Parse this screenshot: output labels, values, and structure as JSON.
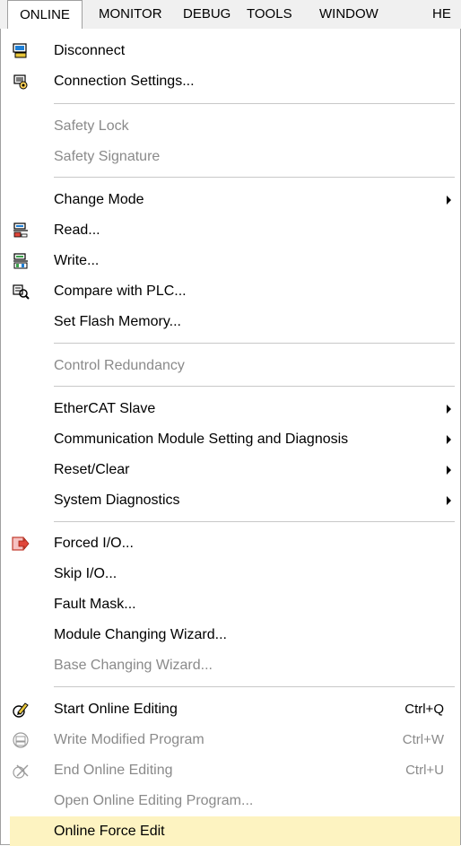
{
  "menubar": {
    "items": [
      "ONLINE",
      "MONITOR",
      "DEBUG",
      "TOOLS",
      "WINDOW",
      "HE"
    ]
  },
  "menu": {
    "disconnect": "Disconnect",
    "connection_settings": "Connection Settings...",
    "safety_lock": "Safety Lock",
    "safety_signature": "Safety Signature",
    "change_mode": "Change Mode",
    "read": "Read...",
    "write": "Write...",
    "compare_with_plc": "Compare with PLC...",
    "set_flash_memory": "Set Flash Memory...",
    "control_redundancy": "Control Redundancy",
    "ethercat_slave": "EtherCAT Slave",
    "comm_module": "Communication Module Setting and Diagnosis",
    "reset_clear": "Reset/Clear",
    "system_diagnostics": "System Diagnostics",
    "forced_io": "Forced I/O...",
    "skip_io": "Skip I/O...",
    "fault_mask": "Fault Mask...",
    "module_changing_wizard": "Module Changing Wizard...",
    "base_changing_wizard": "Base Changing Wizard...",
    "start_online_editing": "Start Online Editing",
    "start_online_editing_shortcut": "Ctrl+Q",
    "write_modified_program": "Write Modified Program",
    "write_modified_program_shortcut": "Ctrl+W",
    "end_online_editing": "End Online Editing",
    "end_online_editing_shortcut": "Ctrl+U",
    "open_online_editing_program": "Open Online Editing Program...",
    "online_force_edit": "Online Force Edit"
  },
  "colors": {
    "highlight": "#fdf3c1",
    "disabled_text": "#8a8a8a",
    "separator": "#c8c8c8"
  },
  "icons": {
    "disconnect": "network-disconnect-icon",
    "connection_settings": "connection-settings-icon",
    "read": "read-from-plc-icon",
    "write": "write-to-plc-icon",
    "compare": "compare-icon",
    "forced_io": "forced-io-icon",
    "start_online_editing": "pencil-edit-icon",
    "write_modified_program": "write-modified-icon",
    "end_online_editing": "end-editing-icon"
  }
}
